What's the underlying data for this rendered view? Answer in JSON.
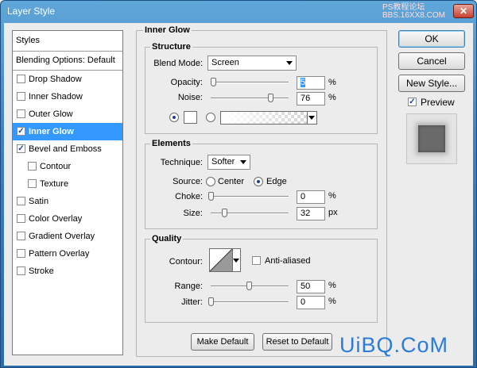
{
  "window": {
    "title": "Layer Style",
    "watermark": "PS教程论坛\nBBS.16XX8.COM",
    "close_glyph": "✕"
  },
  "styles_panel": {
    "header": "Styles",
    "blending_options": "Blending Options: Default",
    "items": [
      {
        "label": "Drop Shadow",
        "checked": false
      },
      {
        "label": "Inner Shadow",
        "checked": false
      },
      {
        "label": "Outer Glow",
        "checked": false
      },
      {
        "label": "Inner Glow",
        "checked": true,
        "selected": true
      },
      {
        "label": "Bevel and Emboss",
        "checked": true
      },
      {
        "label": "Contour",
        "checked": false
      },
      {
        "label": "Texture",
        "checked": false
      },
      {
        "label": "Satin",
        "checked": false
      },
      {
        "label": "Color Overlay",
        "checked": false
      },
      {
        "label": "Gradient Overlay",
        "checked": false
      },
      {
        "label": "Pattern Overlay",
        "checked": false
      },
      {
        "label": "Stroke",
        "checked": false
      }
    ]
  },
  "inner_glow": {
    "title": "Inner Glow",
    "structure": {
      "title": "Structure",
      "blend_mode_label": "Blend Mode:",
      "blend_mode_value": "Screen",
      "opacity_label": "Opacity:",
      "opacity_value": "5",
      "opacity_unit": "%",
      "noise_label": "Noise:",
      "noise_value": "76",
      "noise_unit": "%",
      "glow_color": "#ffffff"
    },
    "elements": {
      "title": "Elements",
      "technique_label": "Technique:",
      "technique_value": "Softer",
      "source_label": "Source:",
      "source_center": "Center",
      "source_edge": "Edge",
      "choke_label": "Choke:",
      "choke_value": "0",
      "choke_unit": "%",
      "size_label": "Size:",
      "size_value": "32",
      "size_unit": "px"
    },
    "quality": {
      "title": "Quality",
      "contour_label": "Contour:",
      "anti_aliased_label": "Anti-aliased",
      "range_label": "Range:",
      "range_value": "50",
      "range_unit": "%",
      "jitter_label": "Jitter:",
      "jitter_value": "0",
      "jitter_unit": "%"
    },
    "make_default": "Make Default",
    "reset_default": "Reset to Default"
  },
  "actions": {
    "ok": "OK",
    "cancel": "Cancel",
    "new_style": "New Style...",
    "preview_label": "Preview",
    "preview_checked": true
  },
  "brand": "UiBQ.CoM"
}
